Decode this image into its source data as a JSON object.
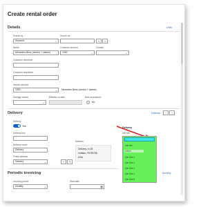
{
  "page": {
    "title": "Create rental order"
  },
  "details": {
    "title": "Details",
    "link": "Units",
    "search_by": {
      "label": "Search by",
      "value": "Keyword"
    },
    "search_for": {
      "label": "Search for"
    },
    "name": {
      "label": "Name",
      "value": "Mercedes-Benz (vendor + claims)"
    },
    "customer_account": {
      "label": "Customer account",
      "value": "1000"
    },
    "contact": {
      "label": "Contact"
    },
    "customer_reference": {
      "label": "Customer reference"
    },
    "customer_requisition": {
      "label": "Customer requisition"
    },
    "invoice_account": {
      "label": "Invoice account",
      "value": "1000",
      "text": "Mercedes Benz (vendor + claims)"
    },
    "damage_waiver": {
      "label": "Damage waiver"
    },
    "effective_to_date": {
      "label": "Effective to date"
    },
    "bulk_acceptance": {
      "label": "Bulk acceptance",
      "option": "No"
    }
  },
  "delivery": {
    "title": "Delivery",
    "mode_label": "Delivery",
    "delivery_label": "Delivery",
    "toggle_text": "Yes",
    "delivery_text": {
      "label": "Delivery text"
    },
    "delivery_name": {
      "label": "Delivery name",
      "value": "Delivery"
    },
    "postal_address": {
      "label": "Postal address",
      "value": "Delivery"
    },
    "address": {
      "label": "Address",
      "lines": [
        "Delivery, in 25",
        "Voltaire, PA 99768",
        "USA"
      ]
    },
    "dropdown": {
      "header": "Delivery",
      "sub": "Job site",
      "items": [
        "Job site",
        "00000",
        "Job Site 1",
        "Job Site 2",
        "Job Site 3",
        "Job Site 4",
        "Job Site 5"
      ]
    }
  },
  "periodic": {
    "title": "Periodic invoicing",
    "link": "Monthly",
    "invoicing_period": {
      "label": "Invoicing period",
      "value": "Monthly"
    },
    "start_date": {
      "label": "Start date"
    }
  },
  "colors": {
    "dropdown_bg": "#66f05a",
    "dropdown_input": "#3ee4f0",
    "arrow": "#d42020",
    "toggle": "#0a63c9",
    "link": "#2a6cb8"
  }
}
